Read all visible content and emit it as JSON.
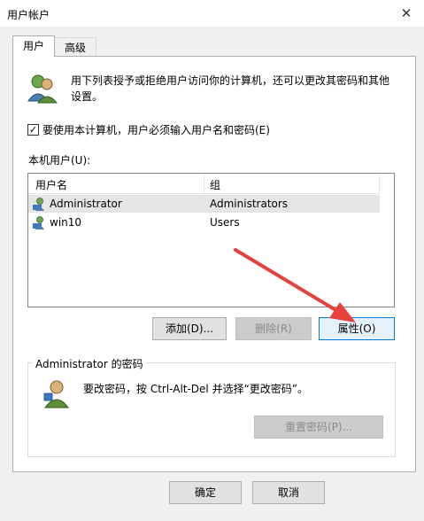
{
  "window": {
    "title": "用户帐户",
    "close_glyph": "✕"
  },
  "tabs": [
    {
      "label": "用户"
    },
    {
      "label": "高级"
    }
  ],
  "intro_text": "用下列表授予或拒绝用户访问你的计算机，还可以更改其密码和其他设置。",
  "require_login": {
    "checked": true,
    "check_glyph": "✓",
    "label": "要使用本计算机，用户必须输入用户名和密码(E)"
  },
  "users_list": {
    "label": "本机用户(U):",
    "columns": [
      "用户名",
      "组"
    ],
    "rows": [
      {
        "name": "Administrator",
        "group": "Administrators",
        "selected": true
      },
      {
        "name": "win10",
        "group": "Users",
        "selected": false
      }
    ]
  },
  "buttons": {
    "add": "添加(D)...",
    "remove": "删除(R)",
    "properties": "属性(O)",
    "reset_password": "重置密码(P)...",
    "ok": "确定",
    "cancel": "取消"
  },
  "password_group": {
    "title": "Administrator 的密码",
    "text": "要改密码，按 Ctrl-Alt-Del 并选择“更改密码”。"
  },
  "colors": {
    "accent": "#0078d7",
    "annotation_arrow": "#e8413c"
  }
}
